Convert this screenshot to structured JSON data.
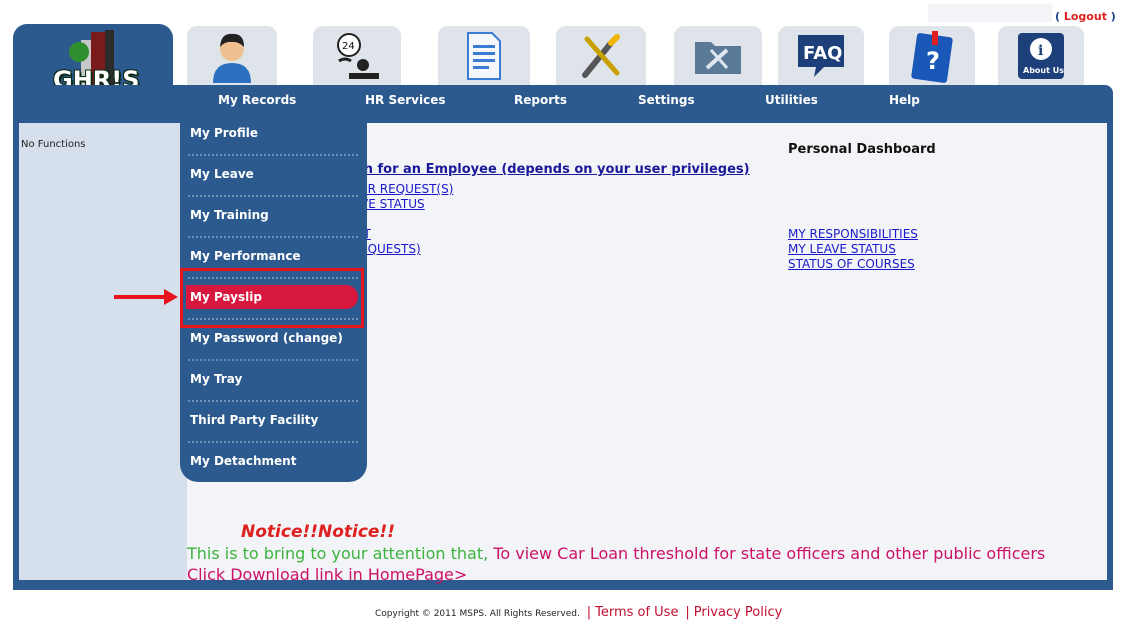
{
  "header": {
    "logout_label": "Logout",
    "logo_text": "GHR!S"
  },
  "icons": [
    {
      "name": "my-records-icon"
    },
    {
      "name": "hr-services-icon"
    },
    {
      "name": "reports-icon"
    },
    {
      "name": "settings-icon"
    },
    {
      "name": "utilities-icon"
    },
    {
      "name": "faq-icon",
      "label": "FAQ"
    },
    {
      "name": "help-icon",
      "label": "?"
    },
    {
      "name": "about-us-icon",
      "label": "About Us"
    }
  ],
  "nav": {
    "my_records": "My Records",
    "hr_services": "HR Services",
    "reports": "Reports",
    "settings": "Settings",
    "utilities": "Utilities",
    "help": "Help"
  },
  "sidebar": {
    "text": "No Functions"
  },
  "dropdown": {
    "items": [
      {
        "label": "My Profile"
      },
      {
        "label": "My Leave"
      },
      {
        "label": "My Training"
      },
      {
        "label": "My Performance"
      },
      {
        "label": "My Payslip",
        "active": true
      },
      {
        "label": "My Password (change)"
      },
      {
        "label": "My Tray"
      },
      {
        "label": "Third Party Facility"
      },
      {
        "label": "My Detachment"
      }
    ]
  },
  "content": {
    "search_link": "ch for an Employee (depends on your user privileges)",
    "left_links": [
      "ER REQUEST(S)",
      "VE STATUS",
      "IT",
      "EQUESTS)"
    ],
    "dashboard_title": "Personal Dashboard",
    "dashboard_links": [
      "MY RESPONSIBILITIES",
      "MY LEAVE STATUS",
      "STATUS OF COURSES"
    ]
  },
  "notice": {
    "title": "Notice!!Notice!!",
    "body_green": "This is to bring to your attention that, ",
    "body_pink": "To view Car Loan threshold for state officers and other public officers Click Download link in HomePage>"
  },
  "footer": {
    "copyright": "Copyright © 2011 MSPS. All Rights Reserved.",
    "terms": "Terms of Use",
    "privacy": "Privacy Policy",
    "separator": "|"
  },
  "colors": {
    "navy": "#2d5a8e",
    "active_red": "#d8173f",
    "annotation_red": "#e8141b"
  }
}
